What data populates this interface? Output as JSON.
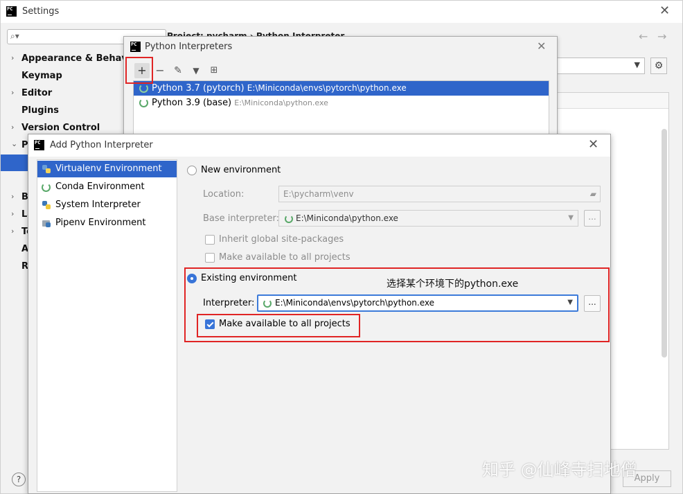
{
  "settings": {
    "title": "Settings",
    "search_placeholder": "",
    "breadcrumb": "Project: pycharm  ›  Python Interpreter",
    "nav": [
      {
        "label": "Appearance & Behavior",
        "arrow": "›"
      },
      {
        "label": "Keymap",
        "arrow": ""
      },
      {
        "label": "Editor",
        "arrow": "›"
      },
      {
        "label": "Plugins",
        "arrow": ""
      },
      {
        "label": "Version Control",
        "arrow": "›"
      },
      {
        "label": "Pr",
        "arrow": "⌄"
      },
      {
        "label": "Bu",
        "arrow": "›"
      },
      {
        "label": "La",
        "arrow": "›"
      },
      {
        "label": "To",
        "arrow": "›"
      },
      {
        "label": "Ad",
        "arrow": ""
      },
      {
        "label": "Ra",
        "arrow": ""
      }
    ],
    "apply_label": "Apply",
    "help_label": "?"
  },
  "interpreters": {
    "title": "Python Interpreters",
    "items": [
      {
        "name": "Python 3.7 (pytorch)",
        "path": "E:\\Miniconda\\envs\\pytorch\\python.exe",
        "selected": true
      },
      {
        "name": "Python 3.9 (base)",
        "path": "E:\\Miniconda\\python.exe",
        "selected": false
      }
    ]
  },
  "add_interpreter": {
    "title": "Add Python Interpreter",
    "env_types": [
      {
        "label": "Virtualenv Environment",
        "selected": true
      },
      {
        "label": "Conda Environment",
        "selected": false
      },
      {
        "label": "System Interpreter",
        "selected": false
      },
      {
        "label": "Pipenv Environment",
        "selected": false
      }
    ],
    "new_env": {
      "radio_label": "New environment",
      "location_label": "Location:",
      "location_value": "E:\\pycharm\\venv",
      "base_label": "Base interpreter:",
      "base_value": "E:\\Miniconda\\python.exe",
      "inherit_label": "Inherit global site-packages",
      "make_available_label": "Make available to all projects"
    },
    "existing_env": {
      "radio_label": "Existing environment",
      "interpreter_label": "Interpreter:",
      "interpreter_value": "E:\\Miniconda\\envs\\pytorch\\python.exe",
      "make_available_label": "Make available to all projects"
    },
    "browse_label": "..."
  },
  "annotation": "选择某个环境下的python.exe",
  "watermark": "知乎 @仙峰寺扫地僧",
  "colors": {
    "accent": "#2f65ca",
    "annotation_red": "#e02424"
  }
}
